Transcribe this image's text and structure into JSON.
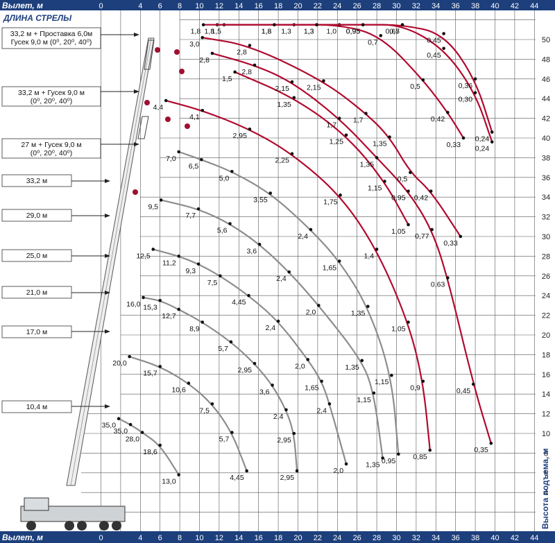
{
  "chart_data": {
    "type": "line",
    "x_axis_label": "Вылет, м",
    "y_axis_label": "Высота подъема, м",
    "boom_length_title": "ДЛИНА СТРЕЛЫ",
    "xlim": [
      0,
      44
    ],
    "ylim": [
      0,
      52
    ],
    "x_ticks": [
      "0",
      "4",
      "6",
      "8",
      "10",
      "12",
      "14",
      "16",
      "18",
      "20",
      "22",
      "24",
      "26",
      "28",
      "30",
      "32",
      "34",
      "36",
      "38",
      "40",
      "42",
      "44"
    ],
    "y_ticks": [
      "4",
      "6",
      "8",
      "10",
      "12",
      "14",
      "16",
      "18",
      "20",
      "22",
      "24",
      "26",
      "28",
      "30",
      "32",
      "34",
      "36",
      "38",
      "40",
      "42",
      "44",
      "46",
      "48",
      "50"
    ],
    "boom_configs": [
      {
        "label": "33,2 м + Проставка 6,0м",
        "label2": "Гусек 9,0 м (0⁰, 20⁰, 40⁰)"
      },
      {
        "label": "33,2 м + Гусек 9,0 м",
        "label2": "(0⁰, 20⁰, 40⁰)"
      },
      {
        "label": "27 м + Гусек 9,0 м",
        "label2": "(0⁰, 20⁰, 40⁰)"
      },
      {
        "label": "33,2 м"
      },
      {
        "label": "29,0 м"
      },
      {
        "label": "25,0 м"
      },
      {
        "label": "21,0 м"
      },
      {
        "label": "17,0 м"
      },
      {
        "label": "10,4 м"
      }
    ],
    "series": [
      {
        "color": "gray",
        "points": [
          {
            "x": 1.8,
            "y": 11.5,
            "label": "35,0"
          },
          {
            "x": 3.0,
            "y": 10.9,
            "label": "35,0"
          },
          {
            "x": 4.2,
            "y": 10.1,
            "label": "28,0"
          },
          {
            "x": 6.0,
            "y": 8.8,
            "label": "18,6"
          },
          {
            "x": 7.9,
            "y": 5.8,
            "label": "13,0"
          }
        ]
      },
      {
        "color": "gray",
        "points": [
          {
            "x": 2.9,
            "y": 17.8,
            "label": "20,0"
          },
          {
            "x": 6.0,
            "y": 16.8,
            "label": "15,7"
          },
          {
            "x": 8.9,
            "y": 15.1,
            "label": "10,6"
          },
          {
            "x": 11.3,
            "y": 13.0,
            "label": "7,5"
          },
          {
            "x": 13.3,
            "y": 10.1,
            "label": "5,7"
          },
          {
            "x": 14.8,
            "y": 6.2,
            "label": "4,45"
          }
        ]
      },
      {
        "color": "gray",
        "points": [
          {
            "x": 4.3,
            "y": 23.8,
            "label": "16,0"
          },
          {
            "x": 6.0,
            "y": 23.5,
            "label": "15,3"
          },
          {
            "x": 7.9,
            "y": 22.6,
            "label": "12,7"
          },
          {
            "x": 10.3,
            "y": 21.3,
            "label": "8,9"
          },
          {
            "x": 13.2,
            "y": 19.3,
            "label": "5,7"
          },
          {
            "x": 15.6,
            "y": 17.1,
            "label": "2,95"
          },
          {
            "x": 17.4,
            "y": 14.9,
            "label": "3,6"
          },
          {
            "x": 18.8,
            "y": 12.4,
            "label": "2,4"
          },
          {
            "x": 19.6,
            "y": 10.0,
            "label": "2,95"
          },
          {
            "x": 19.9,
            "y": 6.2,
            "label": "2,95"
          }
        ]
      },
      {
        "color": "gray",
        "points": [
          {
            "x": 5.3,
            "y": 28.7,
            "label": "12,5"
          },
          {
            "x": 7.9,
            "y": 28.0,
            "label": "11,2"
          },
          {
            "x": 9.9,
            "y": 27.2,
            "label": "9,3"
          },
          {
            "x": 12.1,
            "y": 26.0,
            "label": "7,5"
          },
          {
            "x": 15.0,
            "y": 24.0,
            "label": "4,45"
          },
          {
            "x": 18.0,
            "y": 21.4,
            "label": "2,4"
          },
          {
            "x": 21.0,
            "y": 17.5,
            "label": "2,0"
          },
          {
            "x": 22.4,
            "y": 15.3,
            "label": "1,65"
          },
          {
            "x": 23.2,
            "y": 13.0,
            "label": "2,4"
          },
          {
            "x": 24.9,
            "y": 6.9,
            "label": "2,0"
          }
        ]
      },
      {
        "color": "gray",
        "points": [
          {
            "x": 6.1,
            "y": 33.7,
            "label": "9,5"
          },
          {
            "x": 9.9,
            "y": 32.8,
            "label": "7,7"
          },
          {
            "x": 13.1,
            "y": 31.3,
            "label": "5,6"
          },
          {
            "x": 16.1,
            "y": 29.2,
            "label": "3,6"
          },
          {
            "x": 19.1,
            "y": 26.4,
            "label": "2,4"
          },
          {
            "x": 22.1,
            "y": 23.0,
            "label": "2,0"
          },
          {
            "x": 26.5,
            "y": 17.4,
            "label": "1,35"
          },
          {
            "x": 27.7,
            "y": 14.1,
            "label": "1,15"
          },
          {
            "x": 28.6,
            "y": 7.5,
            "label": "1,35"
          }
        ]
      },
      {
        "color": "gray",
        "points": [
          {
            "x": 7.9,
            "y": 38.6,
            "label": "7,0"
          },
          {
            "x": 10.2,
            "y": 37.8,
            "label": "6,5"
          },
          {
            "x": 13.3,
            "y": 36.6,
            "label": "5,0"
          },
          {
            "x": 17.2,
            "y": 34.4,
            "label": "3,55"
          },
          {
            "x": 21.3,
            "y": 30.7,
            "label": "2,4"
          },
          {
            "x": 24.2,
            "y": 27.5,
            "label": "1,65"
          },
          {
            "x": 27.1,
            "y": 22.9,
            "label": "1,35"
          },
          {
            "x": 29.5,
            "y": 15.9,
            "label": "1,15"
          },
          {
            "x": 30.2,
            "y": 7.9,
            "label": "0,95"
          }
        ]
      },
      {
        "color": "red",
        "points": [
          {
            "x": 6.6,
            "y": 43.8,
            "label": "4,4"
          },
          {
            "x": 10.3,
            "y": 42.8,
            "label": "4,1"
          },
          {
            "x": 15.1,
            "y": 40.9,
            "label": "2,95"
          },
          {
            "x": 19.4,
            "y": 38.4,
            "label": "2,25"
          },
          {
            "x": 24.3,
            "y": 34.2,
            "label": "1,75"
          },
          {
            "x": 28.0,
            "y": 28.7,
            "label": "1,4"
          },
          {
            "x": 31.2,
            "y": 21.3,
            "label": "1,05"
          },
          {
            "x": 32.7,
            "y": 15.3,
            "label": "0,9"
          },
          {
            "x": 33.4,
            "y": 8.3,
            "label": "0,85"
          }
        ]
      },
      {
        "color": "red",
        "points": [
          {
            "x": 13.6,
            "y": 46.7,
            "label": "1,5"
          },
          {
            "x": 19.6,
            "y": 44.1,
            "label": "1,35"
          },
          {
            "x": 24.9,
            "y": 40.3,
            "label": "1,25"
          },
          {
            "x": 28.8,
            "y": 35.6,
            "label": "1,15"
          },
          {
            "x": 31.2,
            "y": 31.2,
            "label": "1,05"
          }
        ]
      },
      {
        "color": "red",
        "points": [
          {
            "x": 11.3,
            "y": 48.6,
            "label": "2,8"
          },
          {
            "x": 15.6,
            "y": 47.4,
            "label": "2,8"
          },
          {
            "x": 19.4,
            "y": 45.7,
            "label": "2,15"
          },
          {
            "x": 24.2,
            "y": 42.0,
            "label": "1,7"
          },
          {
            "x": 28.0,
            "y": 38.0,
            "label": "1,35"
          },
          {
            "x": 31.2,
            "y": 34.6,
            "label": "0,95"
          },
          {
            "x": 33.6,
            "y": 30.7,
            "label": "0,77"
          },
          {
            "x": 35.2,
            "y": 25.8,
            "label": "0,63"
          },
          {
            "x": 37.8,
            "y": 15.0,
            "label": "0,45"
          },
          {
            "x": 39.6,
            "y": 9.0,
            "label": "0,35"
          }
        ]
      },
      {
        "color": "red",
        "points": [
          {
            "x": 10.3,
            "y": 50.2,
            "label": "3,0"
          },
          {
            "x": 15.1,
            "y": 49.4,
            "label": "2,8"
          },
          {
            "x": 22.6,
            "y": 45.8,
            "label": "2,15"
          },
          {
            "x": 26.9,
            "y": 42.5,
            "label": "1,7"
          },
          {
            "x": 29.3,
            "y": 40.1,
            "label": "1,35"
          },
          {
            "x": 31.4,
            "y": 36.5,
            "label": "0,5"
          },
          {
            "x": 33.5,
            "y": 34.6,
            "label": "0,42"
          },
          {
            "x": 36.5,
            "y": 30.0,
            "label": "0,33"
          }
        ]
      },
      {
        "color": "red",
        "points": [
          {
            "x": 12.5,
            "y": 62.2,
            "label": "1,5"
          },
          {
            "x": 19.6,
            "y": 58.4,
            "label": "1,3"
          },
          {
            "x": 24.2,
            "y": 54.6,
            "label": "1,0"
          },
          {
            "x": 28.4,
            "y": 50.4,
            "label": "0,7"
          },
          {
            "x": 32.7,
            "y": 45.9,
            "label": "0,5"
          },
          {
            "x": 35.2,
            "y": 42.6,
            "label": "0,42"
          },
          {
            "x": 36.8,
            "y": 40.0,
            "label": "0,33"
          }
        ]
      },
      {
        "color": "red",
        "points": [
          {
            "x": 11.8,
            "y": 64.9,
            "label": "1,8"
          },
          {
            "x": 17.6,
            "y": 62.5,
            "label": "1,8"
          },
          {
            "x": 21.9,
            "y": 60.3,
            "label": "1,3"
          },
          {
            "x": 26.6,
            "y": 57.5,
            "label": "0,95"
          },
          {
            "x": 30.6,
            "y": 54.2,
            "label": "0,7"
          },
          {
            "x": 34.8,
            "y": 49.1,
            "label": "0,45"
          },
          {
            "x": 38.0,
            "y": 44.6,
            "label": "0,30"
          },
          {
            "x": 39.7,
            "y": 39.6,
            "label": "0,24"
          }
        ]
      },
      {
        "color": "red",
        "points": [
          {
            "x": 10.4,
            "y": 66.6,
            "label": "1,8"
          },
          {
            "x": 17.6,
            "y": 64.0,
            "label": "1,8"
          },
          {
            "x": 21.9,
            "y": 61.7,
            "label": "1,3"
          },
          {
            "x": 26.6,
            "y": 58.7,
            "label": "0,95"
          },
          {
            "x": 30.6,
            "y": 55.4,
            "label": "0,65"
          },
          {
            "x": 34.8,
            "y": 50.6,
            "label": "0,45"
          },
          {
            "x": 38.0,
            "y": 46.0,
            "label": "0,36"
          },
          {
            "x": 39.7,
            "y": 40.6,
            "label": "0,24"
          }
        ]
      }
    ]
  }
}
